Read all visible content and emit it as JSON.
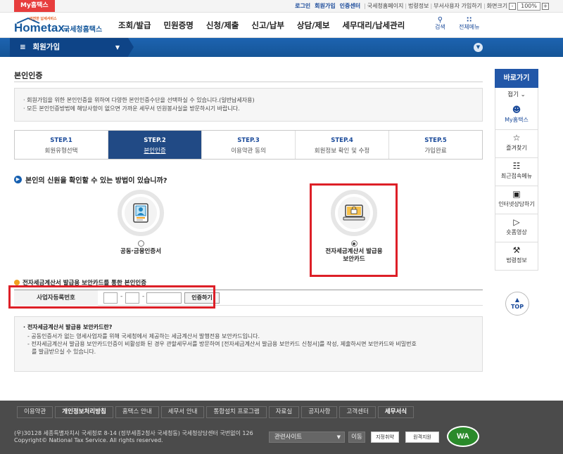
{
  "topbar": {
    "my_tag": "My홈택스",
    "links": [
      "로그인",
      "회원가입",
      "인증센터"
    ],
    "sub_links": [
      "국세청홈페이지",
      "법령정보",
      "부서사용자 가입하기"
    ],
    "zoom_label": "화면크기",
    "zoom_minus": "-",
    "zoom_value": "100%",
    "zoom_plus": "+"
  },
  "header": {
    "logo_tagline": "안전한 납세서비스",
    "logo_home": "Hometax.",
    "logo_kor": "국세청홈택스",
    "nav": [
      "조회/발급",
      "민원증명",
      "신청/제출",
      "신고/납부",
      "상담/제보",
      "세무대리/납세관리"
    ],
    "search_label": "검색",
    "allmenu_label": "전체메뉴"
  },
  "subbar": {
    "menu_label": "회원가입",
    "menu_icon": "hamburger-icon",
    "collapse_glyph": "⌄"
  },
  "page": {
    "title": "본인인증",
    "notice_lines": [
      "· 회원가입을 위한 본인인증을 위하여 다양한 본인인증수단을 선택하실 수 있습니다.(일반납세자용)",
      "· 모든 본인인증방법에 해당사항이 없으면 가까운 세무서 민원봉사실을 방문하시기 바랍니다."
    ],
    "steps": [
      {
        "num": "STEP.1",
        "label": "회원유형선택"
      },
      {
        "num": "STEP.2",
        "label": "본인인증"
      },
      {
        "num": "STEP.3",
        "label": "이용약관 동의"
      },
      {
        "num": "STEP.4",
        "label": "회원정보 확인 및 수정"
      },
      {
        "num": "STEP.5",
        "label": "가입완료"
      }
    ],
    "active_step": 2,
    "question": "본인의 신원을 확인할 수 있는 방법이 있습니까?",
    "options": [
      {
        "label": "공동·금융인증서",
        "selected": false
      },
      {
        "label_line1": "전자세금계산서 발급용",
        "label_line2": "보안카드",
        "selected": true
      }
    ],
    "section_title": "전자세금계산서 발급용 보안카드를 통한 본인인증",
    "form": {
      "field_label": "사업자등록번호",
      "separator": "-",
      "button_label": "인증하기"
    },
    "info": {
      "heading": "· 전자세금계산서 발급용 보안카드란?",
      "lines": [
        "- 공동인증서가 없는 영세사업자를 위해 국세청에서 제공하는 세금계산서 발행전용 보안카드입니다.",
        "- 전자세금계산서 발급용 보안카드인증이 비활성화 된 경우 관할세무서를 방문하여 [전자세금계산서 발급용 보안카드 신청서]를 작성, 제출하시면 보안카드와 비밀번호",
        "를 발급받으실 수 있습니다."
      ]
    }
  },
  "sidebar": {
    "header": "바로가기",
    "fold_label": "접기",
    "items": [
      {
        "label": "My홈택스",
        "icon": "person-icon"
      },
      {
        "label": "즐겨찾기",
        "icon": "star-icon"
      },
      {
        "label": "최근접속메뉴",
        "icon": "recent-icon"
      },
      {
        "label": "인터넷상담하기",
        "icon": "laptop-chat-icon"
      },
      {
        "label": "숏폼영상",
        "icon": "play-icon"
      },
      {
        "label": "법령정보",
        "icon": "gavel-icon"
      }
    ],
    "top_label": "TOP"
  },
  "footer": {
    "nav": [
      "이용약관",
      "개인정보처리방침",
      "홈택스 안내",
      "세무서 안내",
      "통합설치 프로그램",
      "자료실",
      "공지사항",
      "고객센터",
      "세무서식"
    ],
    "address_line1": "(우)30128 세종특별자치시 국세청로 8-14 (정부세종2청사 국세청동) 국세청상담센터 국번없이 126",
    "address_line2": "Copyright© National Tax Service. All rights reserved.",
    "related_select": "관련사이트",
    "go_label": "이동",
    "badge1": "지정취약",
    "badge2": "원격지원",
    "wa_label": "WA"
  },
  "colors": {
    "primary": "#155597",
    "accent_red": "#dd1f27",
    "active_step": "#214a85",
    "footer": "#4b4b4b"
  }
}
